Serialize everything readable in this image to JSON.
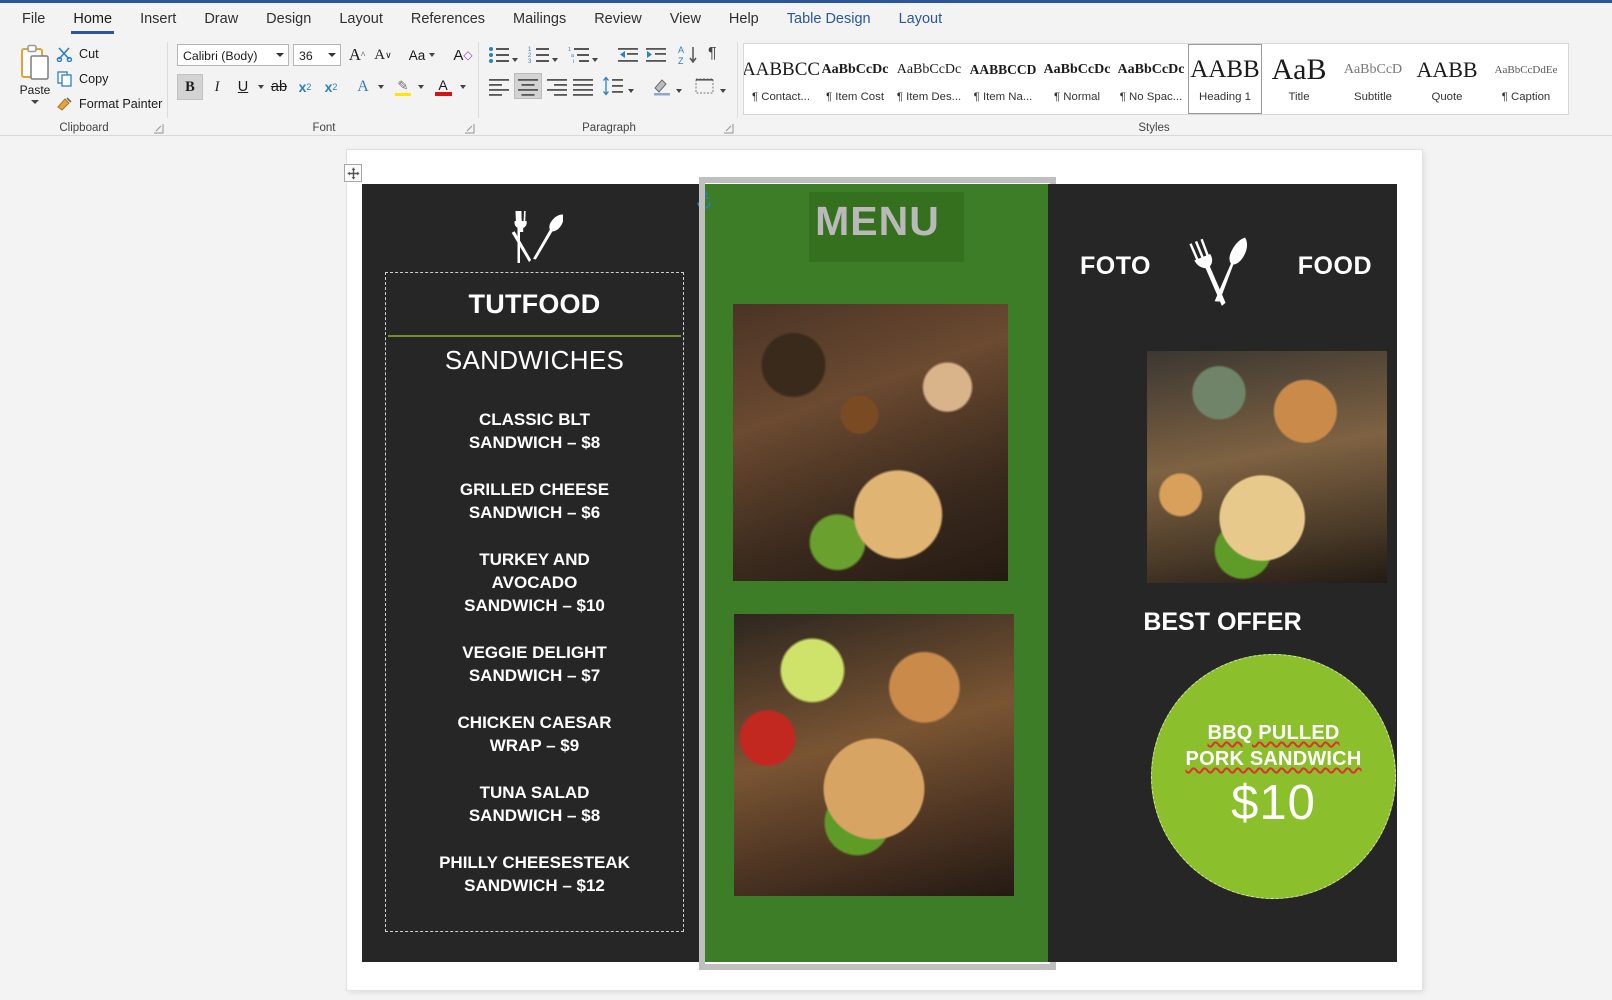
{
  "app": {
    "tabs": [
      {
        "label": "File",
        "kind": "normal"
      },
      {
        "label": "Home",
        "kind": "active"
      },
      {
        "label": "Insert",
        "kind": "normal"
      },
      {
        "label": "Draw",
        "kind": "normal"
      },
      {
        "label": "Design",
        "kind": "normal"
      },
      {
        "label": "Layout",
        "kind": "normal"
      },
      {
        "label": "References",
        "kind": "normal"
      },
      {
        "label": "Mailings",
        "kind": "normal"
      },
      {
        "label": "Review",
        "kind": "normal"
      },
      {
        "label": "View",
        "kind": "normal"
      },
      {
        "label": "Help",
        "kind": "normal"
      },
      {
        "label": "Table Design",
        "kind": "context"
      },
      {
        "label": "Layout",
        "kind": "context"
      }
    ]
  },
  "ribbon": {
    "clipboard": {
      "group_label": "Clipboard",
      "paste_label": "Paste",
      "items": [
        {
          "label": "Cut",
          "icon": "scissors-icon"
        },
        {
          "label": "Copy",
          "icon": "copy-icon"
        },
        {
          "label": "Format Painter",
          "icon": "format-painter-icon"
        }
      ]
    },
    "font": {
      "group_label": "Font",
      "font_name": "Calibri (Body)",
      "font_size": "36",
      "bold_label": "B",
      "italic_label": "I",
      "underline_label": "U",
      "strikethrough_label": "ab",
      "subscript_label": "x",
      "superscript_label": "x",
      "subscript_index": "2",
      "superscript_index": "2",
      "grow_font_label": "A",
      "shrink_font_label": "A",
      "change_case_label": "Aa",
      "clear_formatting_label": "A",
      "text_effects_label": "A",
      "highlight_label": "A",
      "font_color_label": "A",
      "bold_active": true
    },
    "paragraph": {
      "group_label": "Paragraph",
      "bullets_label": "bullets-icon",
      "numbering_label": "numbering-icon",
      "multilevel_label": "multilevel-list-icon",
      "decrease_indent_label": "decrease-indent-icon",
      "increase_indent_label": "increase-indent-icon",
      "sort_label": "sort-icon",
      "marks_label": "¶",
      "align_left_label": "align-left-icon",
      "align_center_label": "align-center-icon",
      "align_right_label": "align-right-icon",
      "justify_label": "justify-icon",
      "line_spacing_label": "line-spacing-icon",
      "shading_label": "shading-icon",
      "borders_label": "borders-icon",
      "align_center_active": true
    },
    "styles": {
      "group_label": "Styles",
      "items": [
        {
          "preview": "AABBCC",
          "name": "¶ Contact...",
          "weight": "normal",
          "size": "19px",
          "selected": false
        },
        {
          "preview": "AaBbCcDc",
          "name": "¶ Item Cost",
          "weight": "bold",
          "size": "14px",
          "selected": false
        },
        {
          "preview": "AaBbCcDc",
          "name": "¶ Item Des...",
          "weight": "normal",
          "size": "14px",
          "selected": false
        },
        {
          "preview": "AABBCCD",
          "name": "¶ Item Na...",
          "weight": "bold",
          "size": "13.5px",
          "selected": false
        },
        {
          "preview": "AaBbCcDc",
          "name": "¶ Normal",
          "weight": "bold",
          "size": "14px",
          "selected": false
        },
        {
          "preview": "AaBbCcDc",
          "name": "¶ No Spac...",
          "weight": "bold",
          "size": "14px",
          "selected": false
        },
        {
          "preview": "AABB",
          "name": "Heading 1",
          "weight": "normal",
          "size": "25px",
          "selected": true
        },
        {
          "preview": "AaB",
          "name": "Title",
          "weight": "normal",
          "size": "30px",
          "selected": false
        },
        {
          "preview": "AaBbCcD",
          "name": "Subtitle",
          "weight": "normal",
          "size": "14px",
          "selected": false
        },
        {
          "preview": "AABB",
          "name": "Quote",
          "weight": "normal",
          "size": "22px",
          "selected": false
        },
        {
          "preview": "AaBbCcDdEe",
          "name": "¶ Caption",
          "weight": "normal",
          "size": "11px",
          "selected": false
        }
      ]
    }
  },
  "document": {
    "table_handle_icon": "move-handle-icon",
    "anchor_icon": "anchor-icon",
    "left_panel": {
      "cutlery_icon": "fork-knife-icon",
      "brand": "TUTFOOD",
      "section": "SANDWICHES",
      "menu_items": [
        {
          "line1": "CLASSIC BLT",
          "line2": "SANDWICH – $8"
        },
        {
          "line1": "GRILLED CHEESE",
          "line2": "SANDWICH – $6"
        },
        {
          "line1": "TURKEY AND",
          "line2": "AVOCADO",
          "line3": "SANDWICH – $10"
        },
        {
          "line1": "VEGGIE DELIGHT",
          "line2": "SANDWICH – $7"
        },
        {
          "line1": "CHICKEN CAESAR",
          "line2": "WRAP – $9"
        },
        {
          "line1": "TUNA SALAD",
          "line2": "SANDWICH – $8"
        },
        {
          "line1": "PHILLY CHEESESTEAK",
          "line2": "SANDWICH – $12"
        }
      ]
    },
    "mid_panel": {
      "title": "MENU",
      "photo_1_alt": "sandwich-coffee-spices-photo",
      "photo_2_alt": "sandwich-tomato-grapes-coffee-photo"
    },
    "right_panel": {
      "word_left": "FOTO",
      "word_right": "FOOD",
      "cutlery_icon": "fork-knife-icon",
      "photo_alt": "toast-sandwich-eggs-latte-photo",
      "best_offer": "BEST OFFER",
      "badge": {
        "line1": "BBQ PULLED",
        "line2": "PORK SANDWICH",
        "price": "$10"
      }
    }
  },
  "colors": {
    "accent_blue": "#2b579a",
    "panel_dark": "#262626",
    "panel_green": "#3d7d28",
    "menu_box_green": "#35701f",
    "badge_green": "#8cbf2c",
    "rule_green": "#6f8f2e",
    "spellcheck_red": "#e03030"
  }
}
